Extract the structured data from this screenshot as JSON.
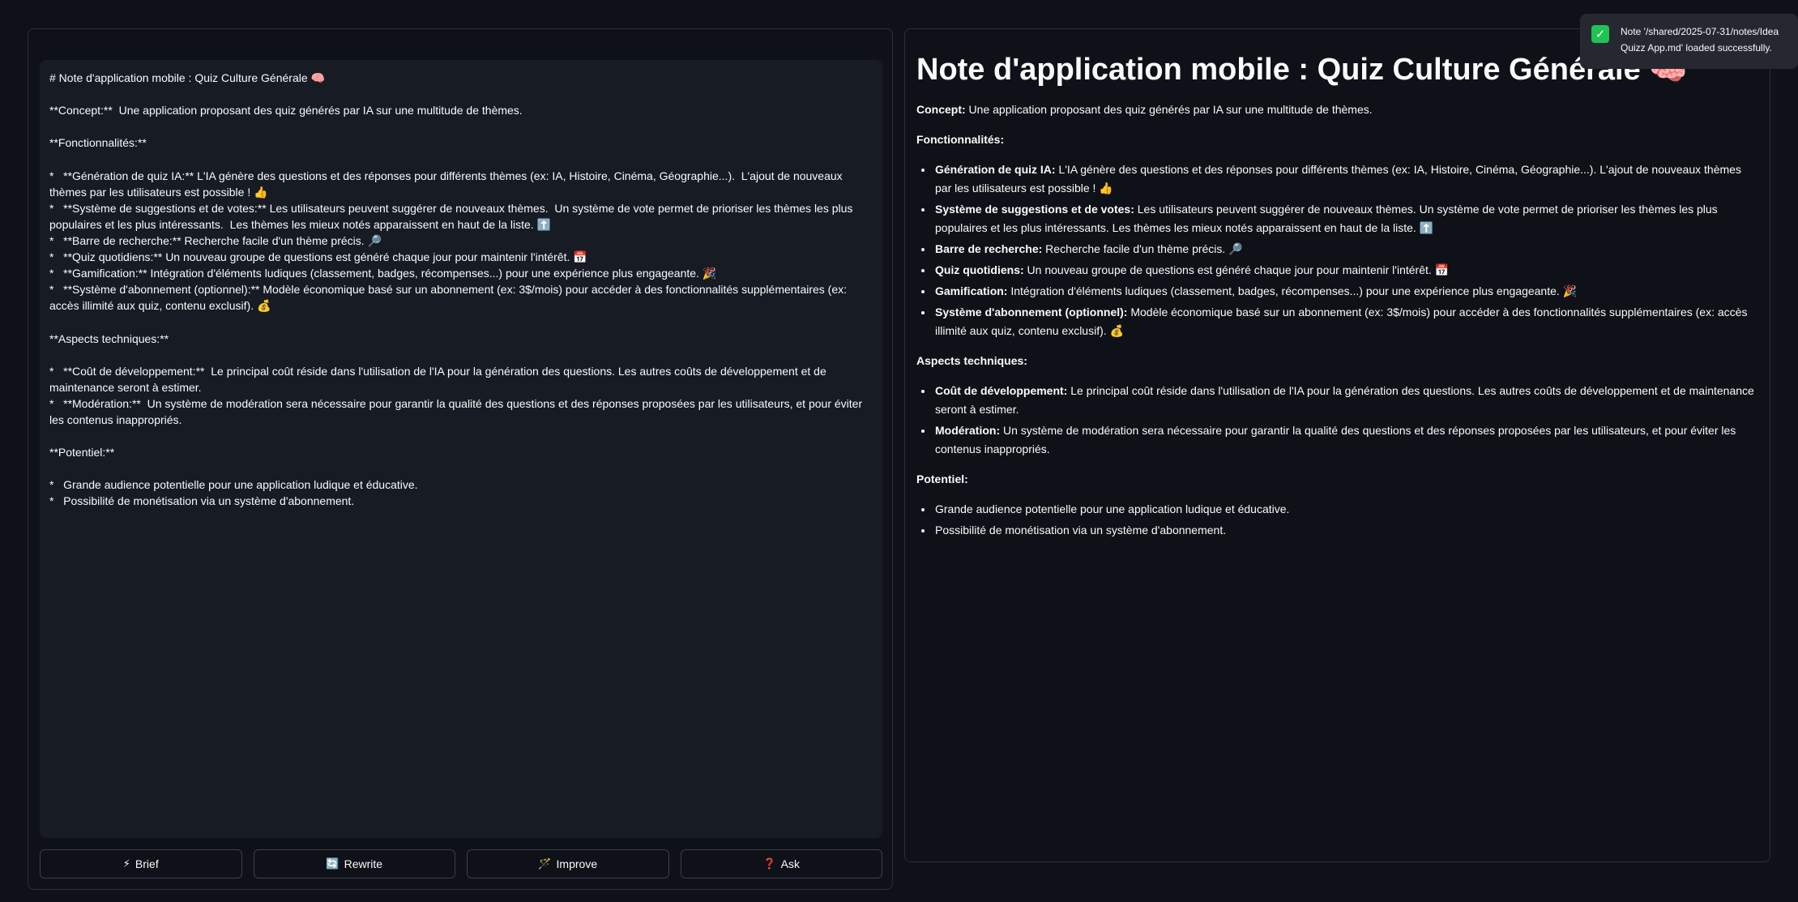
{
  "editor": {
    "content": "# Note d'application mobile : Quiz Culture Générale 🧠\n\n**Concept:**  Une application proposant des quiz générés par IA sur une multitude de thèmes.\n\n**Fonctionnalités:**\n\n*   **Génération de quiz IA:** L'IA génère des questions et des réponses pour différents thèmes (ex: IA, Histoire, Cinéma, Géographie...).  L'ajout de nouveaux thèmes par les utilisateurs est possible ! 👍\n*   **Système de suggestions et de votes:** Les utilisateurs peuvent suggérer de nouveaux thèmes.  Un système de vote permet de prioriser les thèmes les plus populaires et les plus intéressants.  Les thèmes les mieux notés apparaissent en haut de la liste. ⬆️\n*   **Barre de recherche:** Recherche facile d'un thème précis. 🔎\n*   **Quiz quotidiens:** Un nouveau groupe de questions est généré chaque jour pour maintenir l'intérêt. 📅\n*   **Gamification:** Intégration d'éléments ludiques (classement, badges, récompenses...) pour une expérience plus engageante. 🎉\n*   **Système d'abonnement (optionnel):** Modèle économique basé sur un abonnement (ex: 3$/mois) pour accéder à des fonctionnalités supplémentaires (ex: accès illimité aux quiz, contenu exclusif). 💰\n\n**Aspects techniques:**\n\n*   **Coût de développement:**  Le principal coût réside dans l'utilisation de l'IA pour la génération des questions. Les autres coûts de développement et de maintenance seront à estimer.\n*   **Modération:**  Un système de modération sera nécessaire pour garantir la qualité des questions et des réponses proposées par les utilisateurs, et pour éviter les contenus inappropriés.\n\n**Potentiel:**\n\n*   Grande audience potentielle pour une application ludique et éducative.\n*   Possibilité de monétisation via un système d'abonnement."
  },
  "buttons": [
    {
      "icon": "⚡",
      "label": "Brief"
    },
    {
      "icon": "🔄",
      "label": "Rewrite"
    },
    {
      "icon": "🪄",
      "label": "Improve"
    },
    {
      "icon": "❓",
      "label": "Ask"
    }
  ],
  "preview": {
    "title": "Note d'application mobile : Quiz Culture Générale 🧠",
    "concept_label": "Concept:",
    "concept_text": " Une application proposant des quiz générés par IA sur une multitude de thèmes.",
    "features_heading": "Fonctionnalités:",
    "features": [
      {
        "label": "Génération de quiz IA:",
        "text": " L'IA génère des questions et des réponses pour différents thèmes (ex: IA, Histoire, Cinéma, Géographie...). L'ajout de nouveaux thèmes par les utilisateurs est possible ! 👍"
      },
      {
        "label": "Système de suggestions et de votes:",
        "text": " Les utilisateurs peuvent suggérer de nouveaux thèmes. Un système de vote permet de prioriser les thèmes les plus populaires et les plus intéressants. Les thèmes les mieux notés apparaissent en haut de la liste. ⬆️"
      },
      {
        "label": "Barre de recherche:",
        "text": " Recherche facile d'un thème précis. 🔎"
      },
      {
        "label": "Quiz quotidiens:",
        "text": " Un nouveau groupe de questions est généré chaque jour pour maintenir l'intérêt. 📅"
      },
      {
        "label": "Gamification:",
        "text": " Intégration d'éléments ludiques (classement, badges, récompenses...) pour une expérience plus engageante. 🎉"
      },
      {
        "label": "Système d'abonnement (optionnel):",
        "text": " Modèle économique basé sur un abonnement (ex: 3$/mois) pour accéder à des fonctionnalités supplémentaires (ex: accès illimité aux quiz, contenu exclusif). 💰"
      }
    ],
    "tech_heading": "Aspects techniques:",
    "tech": [
      {
        "label": "Coût de développement:",
        "text": " Le principal coût réside dans l'utilisation de l'IA pour la génération des questions. Les autres coûts de développement et de maintenance seront à estimer."
      },
      {
        "label": "Modération:",
        "text": " Un système de modération sera nécessaire pour garantir la qualité des questions et des réponses proposées par les utilisateurs, et pour éviter les contenus inappropriés."
      }
    ],
    "potential_heading": "Potentiel:",
    "potential": [
      "Grande audience potentielle pour une application ludique et éducative.",
      "Possibilité de monétisation via un système d'abonnement."
    ]
  },
  "toast": {
    "icon": "✓",
    "message": "Note '/shared/2025-07-31/notes/Idea Quizz App.md' loaded successfully."
  },
  "colors": {
    "background": "#0e1117",
    "editor_background": "#171b24",
    "toast_success": "#21c354"
  }
}
